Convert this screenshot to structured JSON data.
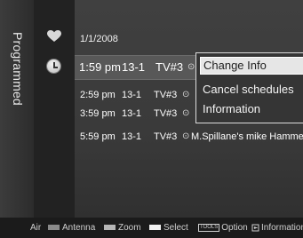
{
  "side": {
    "title": "Programmed"
  },
  "list": {
    "date": "1/1/2008",
    "rows": [
      {
        "time": "1:59 pm",
        "channel": "13-1",
        "source": "TV#3",
        "title": ""
      },
      {
        "time": "2:59 pm",
        "channel": "13-1",
        "source": "TV#3",
        "title": ""
      },
      {
        "time": "3:59 pm",
        "channel": "13-1",
        "source": "TV#3",
        "title": ""
      },
      {
        "time": "5:59 pm",
        "channel": "13-1",
        "source": "TV#3",
        "title": "M.Spillane's mike Hamme"
      }
    ]
  },
  "popup": {
    "items": [
      "Change Info",
      "Cancel schedules",
      "Information"
    ]
  },
  "help": {
    "air": "Air",
    "antenna": "Antenna",
    "zoom": "Zoom",
    "select": "Select",
    "tools_badge": "TOOLS",
    "option": "Option",
    "information": "Information"
  },
  "colors": {
    "background": "#3a3a3a",
    "selection": "#585858",
    "popup_highlight": "#e6e6e6"
  }
}
